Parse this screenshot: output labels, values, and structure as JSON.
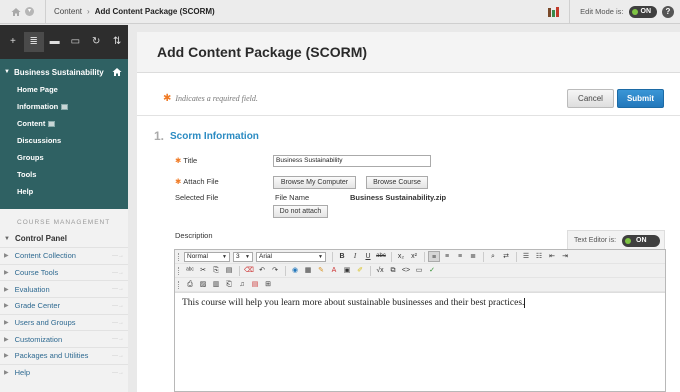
{
  "breadcrumb": {
    "parent": "Content",
    "current": "Add Content Package (SCORM)"
  },
  "edit_mode": {
    "label": "Edit Mode is:",
    "state": "ON"
  },
  "help_glyph": "?",
  "sidebar": {
    "course_title": "Business Sustainability",
    "course_items": [
      {
        "label": "Home Page",
        "has_icon": false
      },
      {
        "label": "Information",
        "has_icon": true
      },
      {
        "label": "Content",
        "has_icon": true
      },
      {
        "label": "Discussions",
        "has_icon": false
      },
      {
        "label": "Groups",
        "has_icon": false
      },
      {
        "label": "Tools",
        "has_icon": false
      },
      {
        "label": "Help",
        "has_icon": false
      }
    ],
    "management_label": "COURSE MANAGEMENT",
    "control_panel_label": "Control Panel",
    "control_panel_items": [
      "Content Collection",
      "Course Tools",
      "Evaluation",
      "Grade Center",
      "Users and Groups",
      "Customization",
      "Packages and Utilities",
      "Help"
    ],
    "toolbar_icons": [
      "add-icon",
      "list-view-icon",
      "folder-icon",
      "window-icon",
      "refresh-icon",
      "sort-icon"
    ]
  },
  "page": {
    "title": "Add Content Package (SCORM)",
    "required_note": "Indicates a required field.",
    "cancel_label": "Cancel",
    "submit_label": "Submit"
  },
  "section": {
    "number": "1.",
    "title": "Scorm Information",
    "title_label": "Title",
    "title_value": "Business Sustainability",
    "attach_label": "Attach File",
    "browse_computer_label": "Browse My Computer",
    "browse_course_label": "Browse Course",
    "selected_file_label": "Selected File",
    "file_name_label": "File Name",
    "file_name_value": "Business Sustainability.zip",
    "do_not_attach_label": "Do not attach",
    "description_label": "Description"
  },
  "editor": {
    "text_editor_label": "Text Editor is:",
    "text_editor_state": "ON",
    "format_value": "Normal",
    "size_value": "3",
    "font_value": "Arial",
    "content": "This course will help you learn more about sustainable businesses and their best practices."
  },
  "colors": {
    "accent": "#2f6163",
    "link": "#2f6a91",
    "submit": "#2277bb",
    "required": "#f07b26",
    "toggle_on": "#7ec443"
  }
}
